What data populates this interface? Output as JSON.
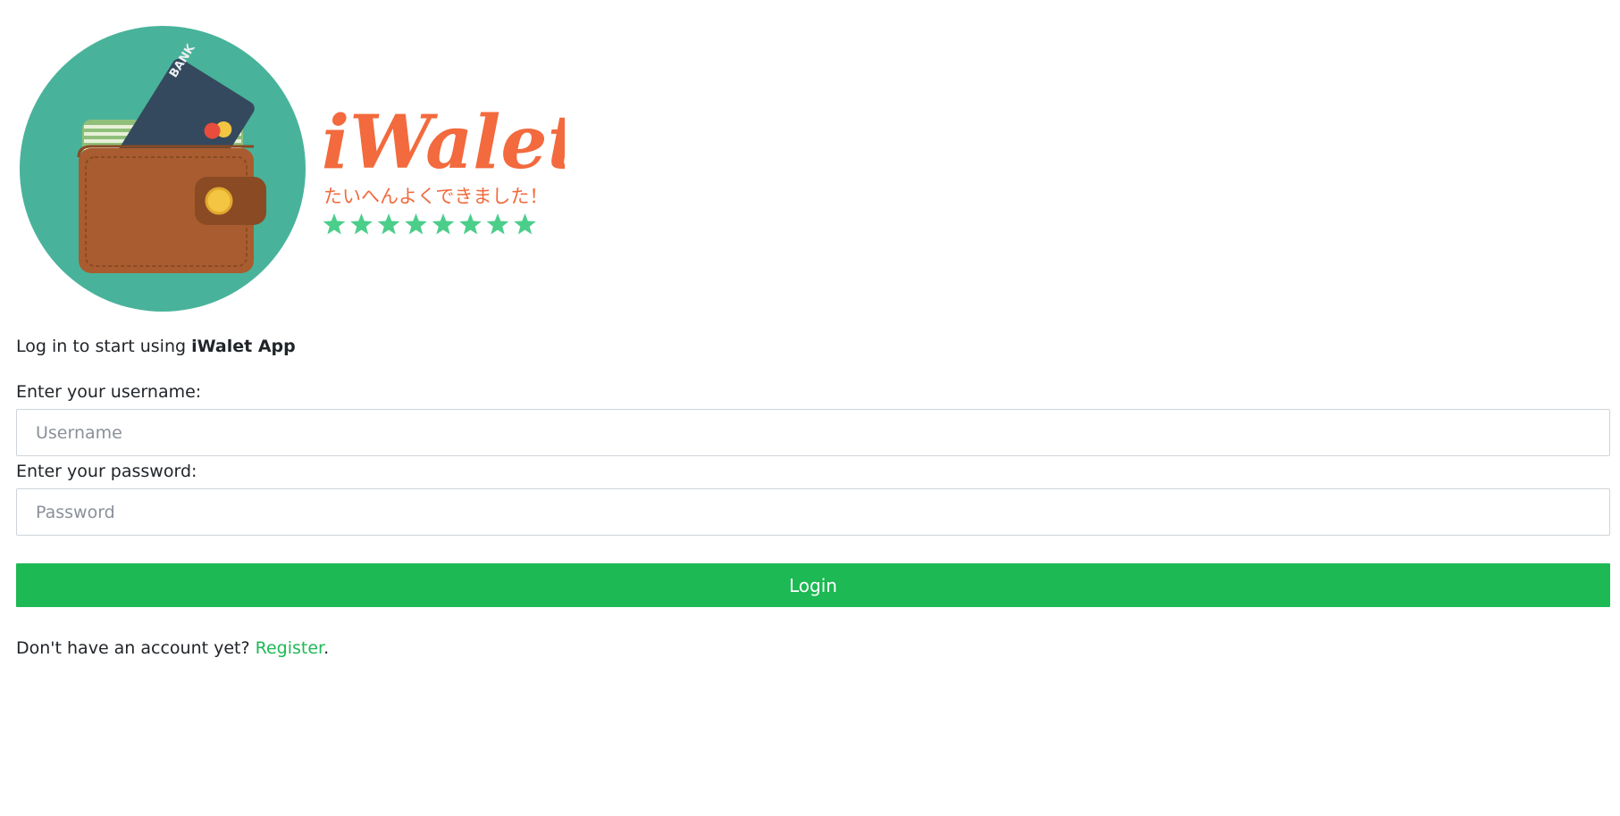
{
  "logo": {
    "brand_text": "iWalet",
    "tagline": "たいへんよくできました！",
    "card_text": "BANK",
    "star_count": 8,
    "colors": {
      "circle": "#48b39a",
      "brand": "#f26a3d",
      "stars": "#4cce8b",
      "wallet": "#a95c2f",
      "card": "#34495e"
    }
  },
  "intro": {
    "prefix": "Log in to start using ",
    "app_name": "iWalet App"
  },
  "form": {
    "username_label": "Enter your username:",
    "username_placeholder": "Username",
    "username_value": "",
    "password_label": "Enter your password:",
    "password_placeholder": "Password",
    "password_value": "",
    "login_label": "Login"
  },
  "register": {
    "prefix": "Don't have an account yet? ",
    "link_label": "Register",
    "suffix": "."
  },
  "colors": {
    "accent": "#1db954"
  }
}
